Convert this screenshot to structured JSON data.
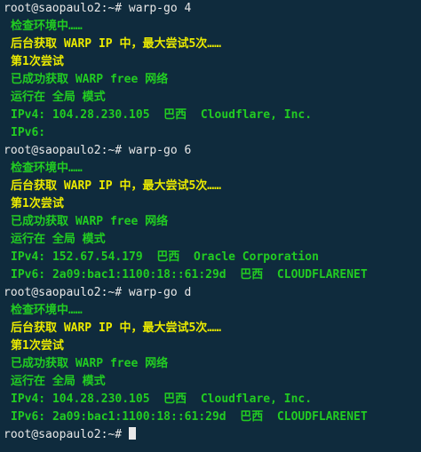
{
  "colors": {
    "background": "#0f2b3d",
    "prompt": "#e8e8e8",
    "green": "#22cc22",
    "yellow": "#eaea00"
  },
  "lines": [
    {
      "text": "root@saopaulo2:~# warp-go 4",
      "style": "prompt"
    },
    {
      "text": "检查环境中……",
      "style": "green"
    },
    {
      "text": "后台获取 WARP IP 中，最大尝试5次……",
      "style": "yellow"
    },
    {
      "text": "第1次尝试",
      "style": "yellow"
    },
    {
      "text": "已成功获取 WARP free 网络",
      "style": "green"
    },
    {
      "text": "运行在 全局 模式",
      "style": "green"
    },
    {
      "text": "IPv4: 104.28.230.105  巴西  Cloudflare, Inc.",
      "style": "green"
    },
    {
      "text": "IPv6:",
      "style": "green"
    },
    {
      "text": "root@saopaulo2:~# warp-go 6",
      "style": "prompt"
    },
    {
      "text": "检查环境中……",
      "style": "green"
    },
    {
      "text": "后台获取 WARP IP 中，最大尝试5次……",
      "style": "yellow"
    },
    {
      "text": "第1次尝试",
      "style": "yellow"
    },
    {
      "text": "已成功获取 WARP free 网络",
      "style": "green"
    },
    {
      "text": "运行在 全局 模式",
      "style": "green"
    },
    {
      "text": "IPv4: 152.67.54.179  巴西  Oracle Corporation",
      "style": "green"
    },
    {
      "text": "IPv6: 2a09:bac1:1100:18::61:29d  巴西  CLOUDFLARENET",
      "style": "green"
    },
    {
      "text": "root@saopaulo2:~# warp-go d",
      "style": "prompt"
    },
    {
      "text": "检查环境中……",
      "style": "green"
    },
    {
      "text": "后台获取 WARP IP 中，最大尝试5次……",
      "style": "yellow"
    },
    {
      "text": "第1次尝试",
      "style": "yellow"
    },
    {
      "text": "已成功获取 WARP free 网络",
      "style": "green"
    },
    {
      "text": "运行在 全局 模式",
      "style": "green"
    },
    {
      "text": "IPv4: 104.28.230.105  巴西  Cloudflare, Inc.",
      "style": "green"
    },
    {
      "text": "IPv6: 2a09:bac1:1100:18::61:29d  巴西  CLOUDFLARENET",
      "style": "green"
    },
    {
      "text": "root@saopaulo2:~# ",
      "style": "prompt",
      "cursor": true
    }
  ]
}
